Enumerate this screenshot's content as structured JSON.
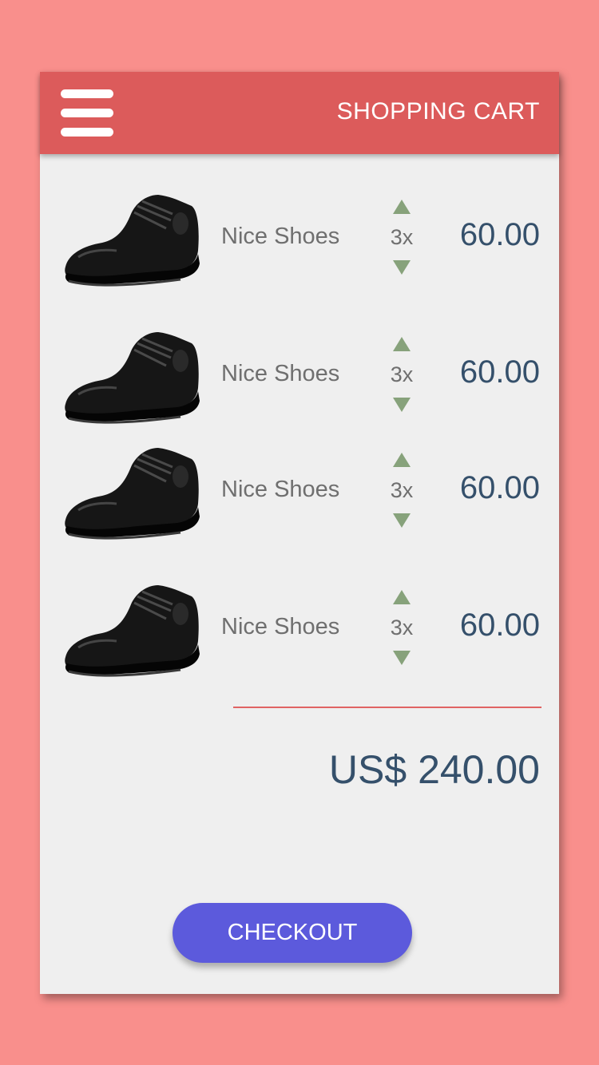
{
  "header": {
    "title": "SHOPPING CART",
    "menu_icon": "hamburger-menu-icon"
  },
  "cart": {
    "items": [
      {
        "name": "Nice Shoes",
        "quantity": "3x",
        "price": "60.00",
        "image": "shoe-image"
      },
      {
        "name": "Nice Shoes",
        "quantity": "3x",
        "price": "60.00",
        "image": "shoe-image"
      },
      {
        "name": "Nice Shoes",
        "quantity": "3x",
        "price": "60.00",
        "image": "shoe-image"
      },
      {
        "name": "Nice Shoes",
        "quantity": "3x",
        "price": "60.00",
        "image": "shoe-image"
      }
    ],
    "total": "US$ 240.00",
    "checkout_label": "CHECKOUT"
  },
  "colors": {
    "background": "#f98f8c",
    "header": "#dc5b5b",
    "card": "#efefef",
    "price_text": "#35506b",
    "arrow": "#87a27b",
    "checkout_button": "#5c5adc",
    "divider": "#e06363"
  }
}
